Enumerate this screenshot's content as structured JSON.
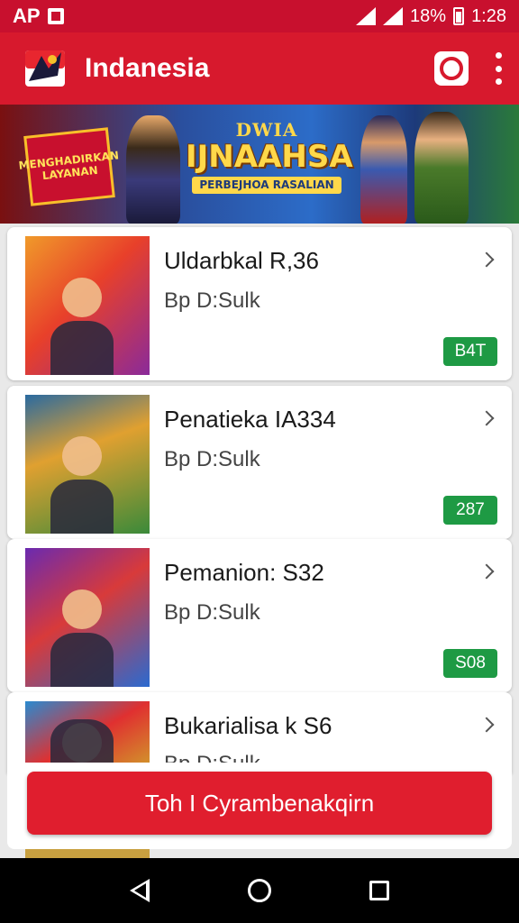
{
  "status_bar": {
    "left_text": "AP",
    "battery": "18%",
    "time": "1:28"
  },
  "app_bar": {
    "title": "Indanesia"
  },
  "banner": {
    "flag_text": "MENGHADIRKAN LAYANAN",
    "title_line1": "DWIA",
    "title_line2": "IJNAAHSA",
    "title_line3": "PERBEJHOA RASALIAN"
  },
  "items": [
    {
      "title": "Uldarbkal R,36",
      "subtitle": "Bp D:Sulk",
      "badge": "B4T",
      "colors": [
        "#f09a2a",
        "#8a2a9a"
      ]
    },
    {
      "title": "Penatieka IA334",
      "subtitle": "Bp D:Sulk",
      "badge": "287",
      "colors": [
        "#2a6aa0",
        "#3a8a3a"
      ]
    },
    {
      "title": "Pemanion: S32",
      "subtitle": "Bp D:Sulk",
      "badge": "S08",
      "colors": [
        "#6a2ab0",
        "#2a6ad0"
      ]
    },
    {
      "title": "Bukarialisa k S6",
      "subtitle": "Bp D:Sulk",
      "badge": "",
      "colors": [
        "#2a8ad0",
        "#d0a02a"
      ]
    }
  ],
  "cta": {
    "label": "Toh I Cyrambenakqirn"
  }
}
